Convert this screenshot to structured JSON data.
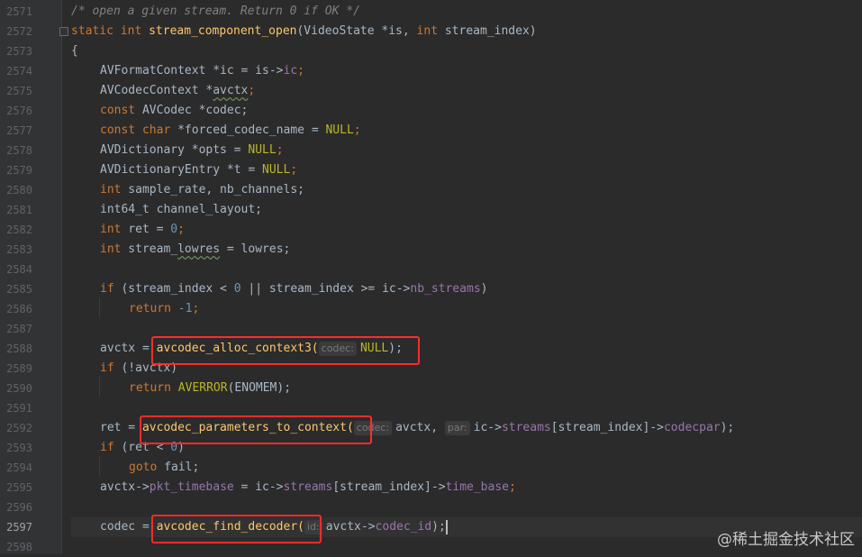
{
  "line_numbers": [
    "2571",
    "2572",
    "2573",
    "2574",
    "2575",
    "2576",
    "2577",
    "2578",
    "2579",
    "2580",
    "2581",
    "2582",
    "2583",
    "2584",
    "2585",
    "2586",
    "2587",
    "2588",
    "2589",
    "2590",
    "2591",
    "2592",
    "2593",
    "2594",
    "2595",
    "2596",
    "2597",
    "2598"
  ],
  "current_line": "2597",
  "code": {
    "l2571": "/* open a given stream. Return 0 if OK */",
    "l2572_kw1": "static",
    "l2572_kw2": "int",
    "l2572_fn": "stream_component_open",
    "l2572_rest1": "(VideoState *is, ",
    "l2572_kw3": "int",
    "l2572_rest2": " stream_index)",
    "l2573": "{",
    "l2574_a": "AVFormatContext *ic = is->",
    "l2574_f": "ic",
    "l2574_b": ";",
    "l2575_a": "AVCodecContext *",
    "l2575_w": "avctx",
    "l2575_b": ";",
    "l2576_kw": "const",
    "l2576_a": " AVCodec *codec;",
    "l2577_kw1": "const",
    "l2577_kw2": "char",
    "l2577_a": " *forced_codec_name = ",
    "l2577_n": "NULL",
    "l2577_b": ";",
    "l2578_a": "AVDictionary *opts = ",
    "l2578_n": "NULL",
    "l2578_b": ";",
    "l2579_a": "AVDictionaryEntry *t = ",
    "l2579_n": "NULL",
    "l2579_b": ";",
    "l2580_kw": "int",
    "l2580_a": " sample_rate, nb_channels;",
    "l2581": "int64_t channel_layout;",
    "l2582_kw": "int",
    "l2582_a": " ret = ",
    "l2582_num": "0",
    "l2582_b": ";",
    "l2583_kw": "int",
    "l2583_a": " stream_",
    "l2583_w": "lowres",
    "l2583_b": " = lowres;",
    "l2585_kw": "if",
    "l2585_a": " (stream_index < ",
    "l2585_num": "0",
    "l2585_b": " || stream_index >= ic->",
    "l2585_f": "nb_streams",
    "l2585_c": ")",
    "l2586_kw": "return",
    "l2586_num": " -1",
    "l2586_b": ";",
    "l2588_a": "avctx = ",
    "l2588_fn": "avcodec_alloc_context3(",
    "l2588_hint": "codec:",
    "l2588_n": "NULL",
    "l2588_b": ");",
    "l2589_kw": "if",
    "l2589_a": " (!avctx)",
    "l2590_kw": "return",
    "l2590_mac": " AVERROR",
    "l2590_a": "(ENOMEM);",
    "l2592_a": "ret = ",
    "l2592_fn": "avcodec_parameters_to_context(",
    "l2592_hint1": "codec:",
    "l2592_b": "avctx, ",
    "l2592_hint2": "par:",
    "l2592_c": "ic->",
    "l2592_f1": "streams",
    "l2592_d": "[stream_index]->",
    "l2592_f2": "codecpar",
    "l2592_e": ");",
    "l2593_kw": "if",
    "l2593_a": " (ret < ",
    "l2593_num": "0",
    "l2593_b": ")",
    "l2594_kw": "goto",
    "l2594_a": " fail;",
    "l2595_a": "avctx->",
    "l2595_f1": "pkt_timebase",
    "l2595_b": " = ic->",
    "l2595_f2": "streams",
    "l2595_c": "[stream_index]->",
    "l2595_f3": "time_base",
    "l2595_d": ";",
    "l2597_a": "codec = ",
    "l2597_fn": "avcodec_find_decoder(",
    "l2597_hint": "id:",
    "l2597_b": "avctx->",
    "l2597_f": "codec_id",
    "l2597_c": ");"
  },
  "watermark": "@稀土掘金技术社区",
  "colors": {
    "background": "#2b2b2b",
    "keyword": "#cc7832",
    "function": "#ffc66d",
    "field": "#9876aa",
    "null": "#bbb529",
    "number": "#6897bb",
    "highlight_box": "#ff2b2b"
  }
}
